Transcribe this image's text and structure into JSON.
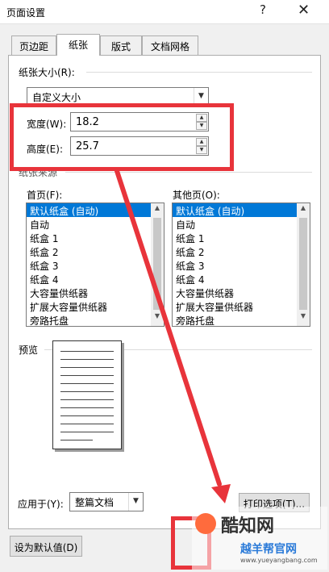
{
  "window": {
    "title": "页面设置",
    "help": "?",
    "close": "✕"
  },
  "tabs": [
    {
      "label": "页边距",
      "active": false
    },
    {
      "label": "纸张",
      "active": true
    },
    {
      "label": "版式",
      "active": false
    },
    {
      "label": "文档网格",
      "active": false
    }
  ],
  "paper_size": {
    "group_label": "纸张大小(R):",
    "selected": "自定义大小",
    "width_label": "宽度(W):",
    "width_value": "18.2",
    "height_label": "高度(E):",
    "height_value": "25.7"
  },
  "paper_source": {
    "group_label": "纸张来源",
    "first_page_label": "首页(F):",
    "other_pages_label": "其他页(O):",
    "first_page_items": [
      "默认纸盒 (自动)",
      "自动",
      "纸盒 1",
      "纸盒 2",
      "纸盒 3",
      "纸盒 4",
      "大容量供纸器",
      "扩展大容量供纸器",
      "旁路托盘"
    ],
    "other_pages_items": [
      "默认纸盒 (自动)",
      "自动",
      "纸盒 1",
      "纸盒 2",
      "纸盒 3",
      "纸盒 4",
      "大容量供纸器",
      "扩展大容量供纸器",
      "旁路托盘"
    ],
    "selected_index": 0
  },
  "preview": {
    "label": "预览",
    "apply_to_label": "应用于(Y):",
    "apply_to_value": "整篇文档",
    "print_options": "打印选项(T)..."
  },
  "footer": {
    "set_default": "设为默认值(D)"
  },
  "watermark": {
    "brand": "酷知网",
    "sub_brand": "越羊帮官网",
    "url": "www.yueyangbang.com"
  },
  "colors": {
    "selection": "#0078d7",
    "highlight_annotation": "#e8343b"
  }
}
